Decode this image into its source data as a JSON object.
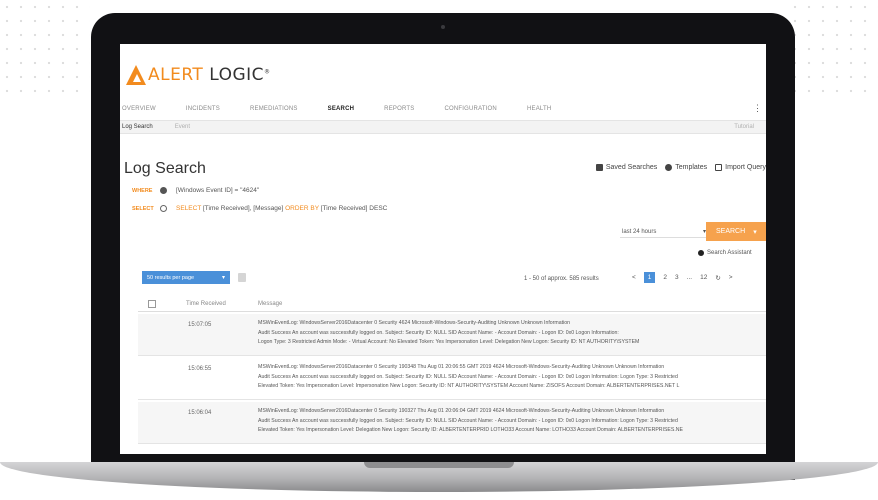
{
  "app": {
    "logo_a": "ALERT",
    "logo_b": "LOGIC",
    "logo_tm": "®"
  },
  "nav": {
    "items": [
      "OVERVIEW",
      "INCIDENTS",
      "REMEDIATIONS",
      "SEARCH",
      "REPORTS",
      "CONFIGURATION",
      "HEALTH"
    ],
    "active": "SEARCH",
    "more_icon": "⋮"
  },
  "subbar": {
    "left": "Log Search",
    "middle": "Event",
    "right": "Tutorial"
  },
  "page": {
    "title": "Log Search",
    "saved_searches": "Saved Searches",
    "templates": "Templates",
    "import_query": "Import Query"
  },
  "query": {
    "where_label": "WHERE",
    "where_value": "[Windows Event ID] = \"4624\"",
    "select_label": "SELECT",
    "select_kw": "SELECT",
    "select_fields": " [Time Received], [Message] ",
    "order_kw": "ORDER BY",
    "order_fields": " [Time Received] DESC"
  },
  "controls": {
    "time_range": "last 24 hours",
    "time_caret": "▾",
    "search_label": "SEARCH",
    "search_caret": "▾",
    "assistant": "Search Assistant",
    "per_page": "50 results per page",
    "per_page_caret": "▾"
  },
  "results": {
    "text": "1 - 50 of approx. 585 results",
    "pages": [
      "<",
      "1",
      "2",
      "3",
      "...",
      "12",
      "↻",
      ">"
    ],
    "current_page": "1"
  },
  "table": {
    "columns": [
      "Time Received",
      "Message"
    ],
    "rows": [
      {
        "time": "15:07:05",
        "lines": [
          "MSWinEventLog: WindowsServer2016Datacenter 0 Security 4624 Microsoft-Windows-Security-Auditing Unknown Unknown Information",
          "Audit Success An account was successfully logged on. Subject: Security ID: NULL SID Account Name: - Account Domain: - Logon ID: 0x0 Logon Information:",
          "Logon Type: 3 Restricted Admin Mode: - Virtual Account: No Elevated Token: Yes Impersonation Level: Delegation New Logon: Security ID: NT AUTHORITY\\SYSTEM"
        ]
      },
      {
        "time": "15:06:55",
        "lines": [
          "MSWinEventLog: WindowsServer2016Datacenter 0 Security 190348 Thu Aug 01 20:06:55 GMT 2019 4624 Microsoft-Windows-Security-Auditing Unknown Unknown Information",
          "Audit Success An account was successfully logged on. Subject: Security ID: NULL SID Account Name: - Account Domain: - Logon ID: 0x0 Logon Information: Logon Type: 3 Restricted",
          "Elevated Token: Yes Impersonation Level: Impersonation New Logon: Security ID: NT AUTHORITY\\SYSTEM Account Name: ZISOFS Account Domain: ALBERTENTERPRISES.NET L"
        ]
      },
      {
        "time": "15:06:04",
        "lines": [
          "MSWinEventLog: WindowsServer2016Datacenter 0 Security 190327 Thu Aug 01 20:06:04 GMT 2019 4624 Microsoft-Windows-Security-Auditing Unknown Unknown Information",
          "Audit Success An account was successfully logged on. Subject: Security ID: NULL SID Account Name: - Account Domain: - Logon ID: 0x0 Logon Information: Logon Type: 3 Restricted",
          "Elevated Token: Yes Impersonation Level: Delegation New Logon: Security ID: ALBERTENTERPRID LOTHO33 Account Name: LOTHO33 Account Domain: ALBERTENTERPRISES.NE"
        ]
      }
    ]
  },
  "colors": {
    "brand": "#f28b1e",
    "accent": "#4a90d9",
    "search_button": "#f6a24d"
  }
}
